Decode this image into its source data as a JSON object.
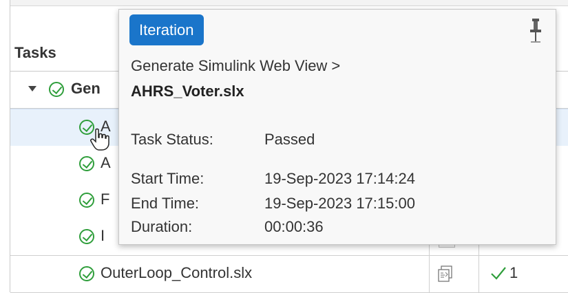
{
  "table": {
    "tasks_header": "Tasks",
    "group_row": {
      "label_partial": "Gen"
    },
    "rows": [
      {
        "label_partial": "A"
      },
      {
        "label_partial": "A"
      },
      {
        "label_partial": "F"
      },
      {
        "label_partial": "I"
      },
      {
        "label": "OuterLoop_Control.slx",
        "count": "1"
      }
    ]
  },
  "tooltip": {
    "badge": "Iteration",
    "title_line1": "Generate Simulink Web View >",
    "title_line2": "AHRS_Voter.slx",
    "status_label": "Task Status:",
    "status_value": "Passed",
    "start_label": "Start Time:",
    "start_value": "19-Sep-2023 17:14:24",
    "end_label": "End Time:",
    "end_value": "19-Sep-2023 17:15:00",
    "duration_label": "Duration:",
    "duration_value": "00:00:36"
  },
  "colors": {
    "accent": "#1a75ca",
    "passed_green": "#2f9e3b",
    "selected_row": "#e8f1fb"
  },
  "icons": [
    "check-circle-icon",
    "chevron-down-icon",
    "pin-icon",
    "hand-cursor-icon",
    "report-icon",
    "checkmark-icon"
  ]
}
